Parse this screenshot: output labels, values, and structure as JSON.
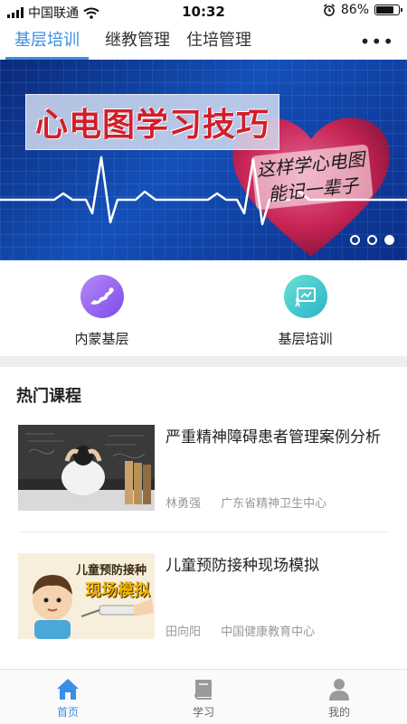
{
  "status_bar": {
    "carrier": "中国联通",
    "time": "10:32",
    "battery": "86%",
    "battery_level": 0.86
  },
  "top_tabs": [
    {
      "label": "基层培训",
      "active": true
    },
    {
      "label": "继教管理",
      "active": false
    },
    {
      "label": "住培管理",
      "active": false
    }
  ],
  "more_label": "•••",
  "banner": {
    "title": "心电图学习技巧",
    "subtitle_line1": "这样学心电图",
    "subtitle_line2": "能记一辈子",
    "slide_count": 3,
    "active_slide": 3
  },
  "quick_links": [
    {
      "label": "内蒙基层",
      "icon": "inner-mongolia-map-icon",
      "color": "#8a5cf0"
    },
    {
      "label": "基层培训",
      "icon": "presentation-board-icon",
      "color": "#35c0cc"
    }
  ],
  "hot_courses": {
    "title": "热门课程",
    "items": [
      {
        "title": "严重精神障碍患者管理案例分析",
        "author": "林勇强",
        "org": "广东省精神卫生中心"
      },
      {
        "title": "儿童预防接种现场模拟",
        "author": "田向阳",
        "org": "中国健康教育中心",
        "thumb_text_1": "儿童预防接种",
        "thumb_text_2": "现场模拟"
      }
    ]
  },
  "bottom_nav": [
    {
      "label": "首页",
      "icon": "home-icon",
      "active": true
    },
    {
      "label": "学习",
      "icon": "book-icon",
      "active": false
    },
    {
      "label": "我的",
      "icon": "user-icon",
      "active": false
    }
  ],
  "colors": {
    "accent": "#3a8ee6",
    "banner_title": "#d21e2b"
  }
}
